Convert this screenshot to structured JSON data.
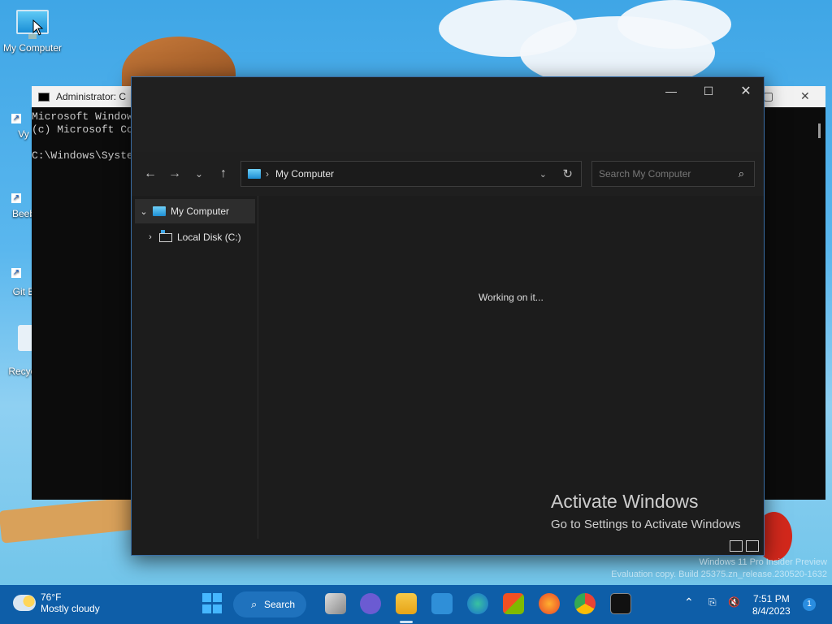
{
  "desktop": {
    "icons": [
      {
        "label": "My Computer"
      },
      {
        "label": "Vy"
      },
      {
        "label": "Beeb"
      },
      {
        "label": "Git B"
      },
      {
        "label": "Recyc"
      }
    ]
  },
  "cmd": {
    "title": "Administrator: C",
    "lines": [
      "Microsoft Window",
      "(c) Microsoft Co",
      "",
      "C:\\Windows\\Syste"
    ]
  },
  "explorer": {
    "address": {
      "location": "My Computer",
      "separator": "›"
    },
    "search_placeholder": "Search My Computer",
    "tree": [
      {
        "label": "My Computer",
        "expanded": true
      },
      {
        "label": "Local Disk (C:)",
        "expanded": false
      }
    ],
    "status_message": "Working on it..."
  },
  "watermark": {
    "title": "Activate Windows",
    "subtitle": "Go to Settings to Activate Windows"
  },
  "build_info": {
    "line1": "Windows 11 Pro Insider Preview",
    "line2": "Evaluation copy. Build 25375.zn_release.230520-1632"
  },
  "taskbar": {
    "weather_temp": "76°F",
    "weather_desc": "Mostly cloudy",
    "search_label": "Search",
    "time": "7:51 PM",
    "date": "8/4/2023",
    "notification_count": "1"
  },
  "colors": {
    "taskbar": "#0e5ea8",
    "explorer_bg": "#1c1c1c",
    "accent": "#45b7ff"
  }
}
